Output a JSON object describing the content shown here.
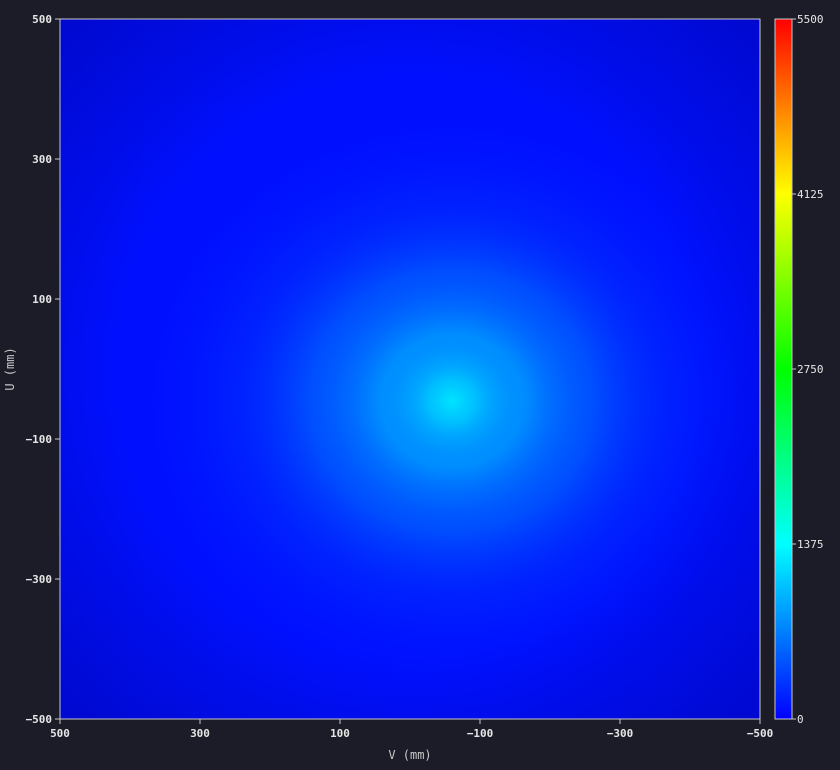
{
  "chart_data": {
    "type": "heatmap",
    "title": "",
    "xlabel": "V (mm)",
    "ylabel": "U (mm)",
    "xlim": [
      500,
      -500
    ],
    "ylim": [
      -500,
      500
    ],
    "x_ticks": [
      "500",
      "300",
      "100",
      "−100",
      "−300",
      "−500"
    ],
    "x_tick_values": [
      500,
      300,
      100,
      -100,
      -300,
      -500
    ],
    "y_ticks": [
      "500",
      "300",
      "100",
      "−100",
      "−300",
      "−500"
    ],
    "y_tick_values": [
      500,
      300,
      100,
      -100,
      -300,
      -500
    ],
    "colorbar": {
      "min": 0,
      "max": 5500,
      "ticks": [
        "5500",
        "4125",
        "2750",
        "1375",
        "0"
      ],
      "tick_values": [
        5500,
        4125,
        2750,
        1375,
        0
      ],
      "colormap": "jet"
    },
    "peak": {
      "v_mm": -60,
      "u_mm": -60,
      "value": 1400
    },
    "background_value": 150,
    "colors": {
      "background": "#1c1c28",
      "axis": "#c8c8c8"
    }
  }
}
